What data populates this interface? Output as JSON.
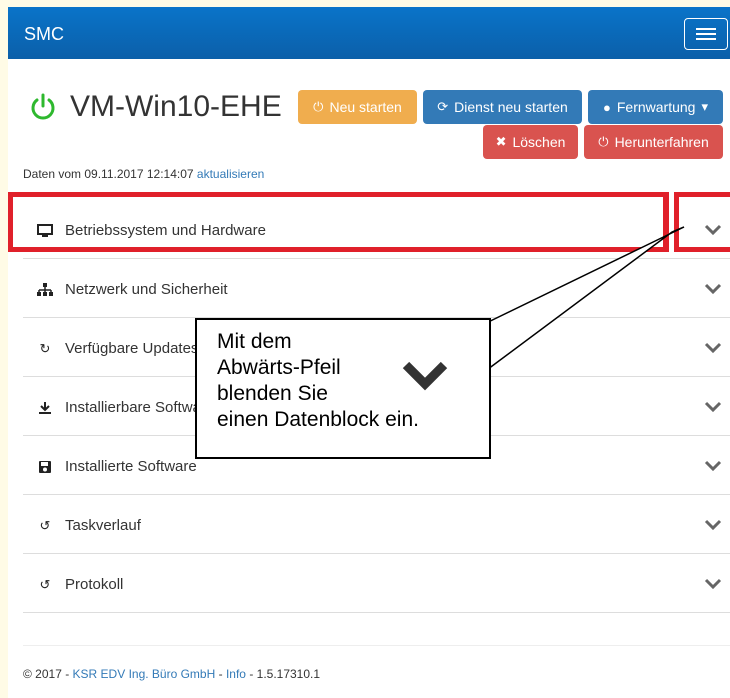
{
  "navbar": {
    "brand": "SMC"
  },
  "header": {
    "title": "VM-Win10-EHE"
  },
  "buttons": {
    "neu_starten": "Neu starten",
    "dienst_neu_starten": "Dienst neu starten",
    "fernwartung": "Fernwartung",
    "loeschen": "Löschen",
    "herunterfahren": "Herunterfahren"
  },
  "status": {
    "text": "Daten vom 09.11.2017 12:14:07",
    "refresh": "aktualisieren"
  },
  "sections": [
    {
      "label": "Betriebssystem und Hardware",
      "icon": "monitor-icon"
    },
    {
      "label": "Netzwerk und Sicherheit",
      "icon": "sitemap-icon"
    },
    {
      "label": "Verfügbare Updates",
      "icon": "refresh-icon"
    },
    {
      "label": "Installierbare Software",
      "icon": "download-icon"
    },
    {
      "label": "Installierte Software",
      "icon": "save-icon"
    },
    {
      "label": "Taskverlauf",
      "icon": "history-icon"
    },
    {
      "label": "Protokoll",
      "icon": "history-icon"
    }
  ],
  "callout": {
    "lines": [
      "Mit dem",
      "Abwärts-Pfeil",
      "blenden Sie",
      "einen Datenblock ein."
    ]
  },
  "footer": {
    "copyright": "© 2017 -",
    "company": "KSR EDV Ing. Büro GmbH",
    "sep1": "-",
    "info": "Info",
    "version": "- 1.5.17310.1"
  },
  "colors": {
    "navbar": "#0b65b4",
    "warning": "#f0ad4e",
    "primary": "#337ab7",
    "danger": "#d9534f",
    "power_green": "#2eb82e",
    "highlight": "#e0202a"
  }
}
